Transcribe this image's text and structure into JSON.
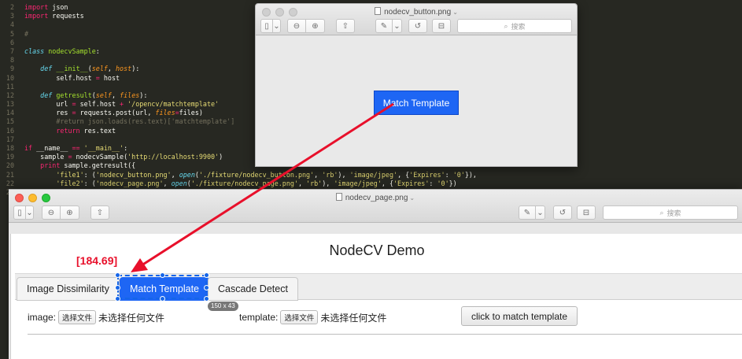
{
  "editor": {
    "line_numbers": [
      "2",
      "3",
      "4",
      "5",
      "6",
      "7",
      "8",
      "9",
      "10",
      "11",
      "12",
      "13",
      "14",
      "15",
      "16",
      "17",
      "18",
      "19",
      "20",
      "21",
      "22",
      "23"
    ]
  },
  "preview1": {
    "title": "nodecv_button.png",
    "title_chevron": "⌄",
    "search_placeholder": "搜索",
    "content_button_label": "Match Template"
  },
  "preview2": {
    "title": "nodecv_page.png",
    "title_chevron": "⌄",
    "search_placeholder": "搜索",
    "page": {
      "heading": "NodeCV Demo",
      "tabs": [
        {
          "label": "Image Dissimilarity"
        },
        {
          "label": "Match Template"
        },
        {
          "label": "Cascade Detect"
        }
      ],
      "image_label": "image:",
      "template_label": "template:",
      "file_button": "选择文件",
      "no_file_text": "未选择任何文件",
      "submit_label": "click to match template"
    }
  },
  "annotation": {
    "coordinate_label": "[184.69]",
    "size_badge": "150 x 43",
    "accent_color": "#e8102b",
    "selection_color": "#1565e8"
  },
  "icons": [
    "sidebar-toggle-icon",
    "zoom-out-icon",
    "zoom-in-icon",
    "share-icon",
    "markup-pen-icon",
    "rotate-icon",
    "toolbox-icon",
    "search-icon",
    "document-icon"
  ]
}
